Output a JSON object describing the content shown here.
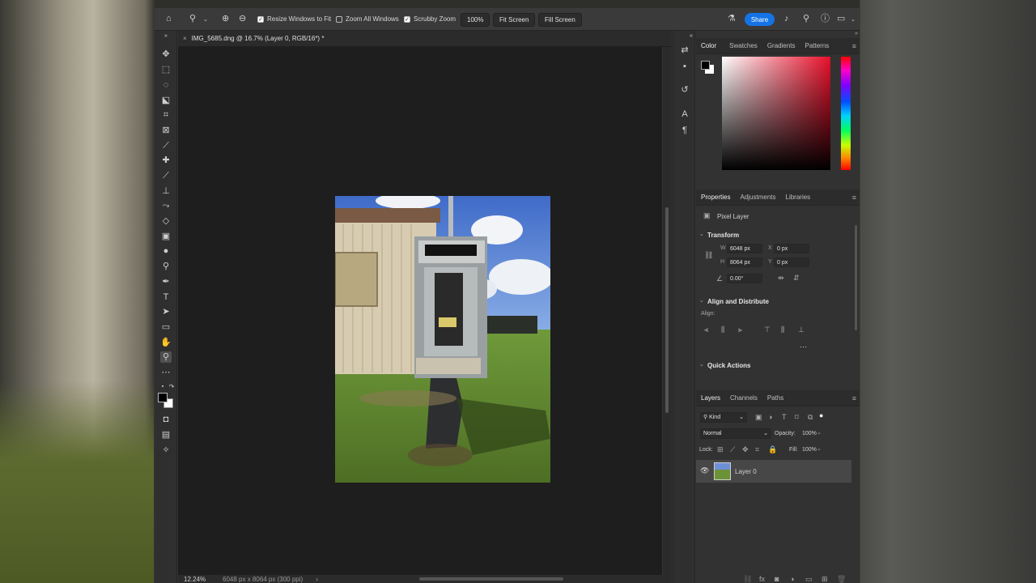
{
  "options_bar": {
    "resize_windows": "Resize Windows to Fit",
    "zoom_all": "Zoom All Windows",
    "scrubby_zoom": "Scrubby Zoom",
    "zoom_value": "100%",
    "fit_screen": "Fit Screen",
    "fill_screen": "Fill Screen",
    "share": "Share"
  },
  "document": {
    "tab_title": "IMG_5685.dng @ 16.7% (Layer 0, RGB/16*) *",
    "zoom": "12.24%",
    "info": "6048 px x 8064 px (300 ppi)"
  },
  "color_panel": {
    "tabs": [
      "Color",
      "Swatches",
      "Gradients",
      "Patterns"
    ]
  },
  "properties_panel": {
    "tabs": [
      "Properties",
      "Adjustments",
      "Libraries"
    ],
    "layer_type": "Pixel Layer",
    "transform_title": "Transform",
    "w_label": "W",
    "w_value": "6048 px",
    "h_label": "H",
    "h_value": "8064 px",
    "x_label": "X",
    "x_value": "0 px",
    "y_label": "Y",
    "y_value": "0 px",
    "angle": "0.00°",
    "align_title": "Align and Distribute",
    "align_label": "Align:",
    "quick_actions": "Quick Actions"
  },
  "layers_panel": {
    "tabs": [
      "Layers",
      "Channels",
      "Paths"
    ],
    "filter": "Kind",
    "blend": "Normal",
    "opacity_label": "Opacity:",
    "opacity": "100%",
    "lock_label": "Lock:",
    "fill_label": "Fill:",
    "fill": "100%",
    "layer_name": "Layer 0"
  },
  "colors": {
    "accent": "#1473e6",
    "foreground": "#000000",
    "background": "#ffffff"
  }
}
